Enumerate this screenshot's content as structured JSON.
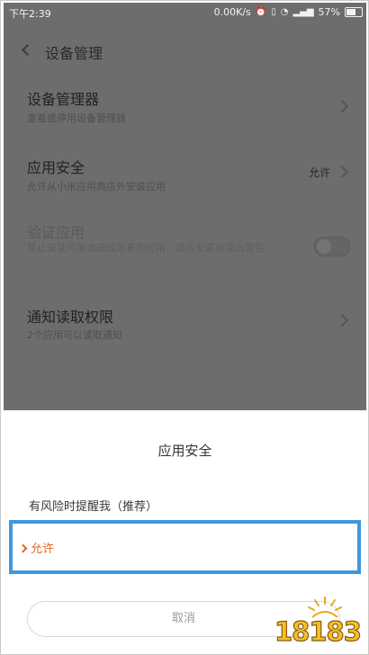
{
  "status_bar": {
    "time": "下午2:39",
    "network_speed": "0.00K/s",
    "battery": "57%",
    "battery_level": 0.57
  },
  "header": {
    "title": "设备管理"
  },
  "settings": {
    "device_admin": {
      "title": "设备管理器",
      "subtitle": "查看或停用设备管理器"
    },
    "app_security": {
      "title": "应用安全",
      "subtitle": "允许从小米应用商店外安装应用",
      "value": "允许"
    },
    "verify_apps": {
      "title": "验证应用",
      "subtitle": "禁止安装可能会造成危害的应用，或在安装前提出警告",
      "enabled": false
    },
    "notification_access": {
      "title": "通知读取权限",
      "subtitle": "2个应用可以读取通知"
    }
  },
  "dialog": {
    "title": "应用安全",
    "options": [
      {
        "label": "有风险时提醒我（推荐）",
        "selected": false
      },
      {
        "label": "允许",
        "selected": true
      }
    ],
    "cancel_label": "取消"
  },
  "watermark": {
    "text": "18183"
  },
  "colors": {
    "overlay": "#6d6d6d",
    "accent_orange": "#e06a1a",
    "highlight_blue": "#3d98e0"
  }
}
